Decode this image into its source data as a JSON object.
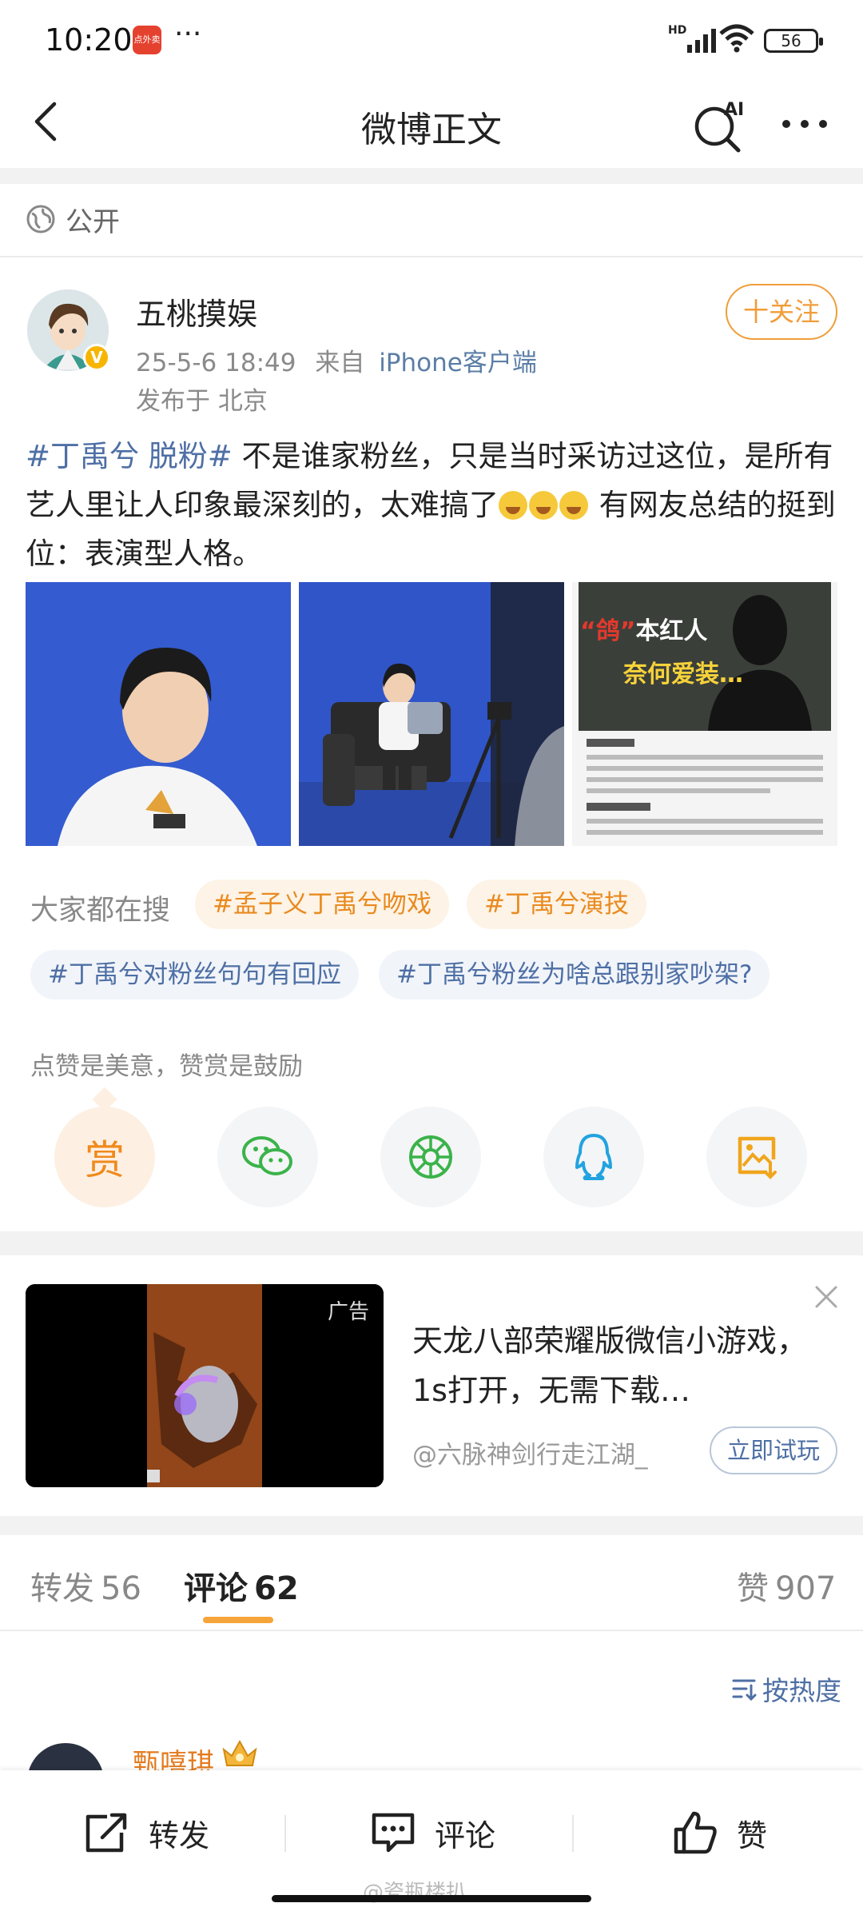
{
  "status_bar": {
    "time": "10:20",
    "app_icon_text": "点外卖",
    "dots": "···",
    "network": "HD",
    "battery": "56"
  },
  "nav": {
    "title": "微博正文",
    "ai_label": "AI"
  },
  "visibility": "公开",
  "author": {
    "name": "五桃摸娱",
    "time": "25-5-6 18:49",
    "from_prefix": "来自",
    "client": "iPhone客户端",
    "location": "发布于 北京",
    "follow_label": "十关注"
  },
  "post": {
    "tag": "#丁禹兮 脱粉#",
    "text_before_emoji": " 不是谁家粉丝，只是当时采访过这位，是所有艺人里让人印象最深刻的，太难搞了",
    "text_after_emoji": " 有网友总结的挺到位：表演型人格。",
    "image3_caption_line1_quote": "“鸽”",
    "image3_caption_line1_rest": "本红人",
    "image3_caption_line2": "奈何爱装…"
  },
  "hot_search": {
    "label": "大家都在搜",
    "chips": [
      "#孟子义丁禹兮吻戏",
      "#丁禹兮演技",
      "#丁禹兮对粉丝句句有回应",
      "#丁禹兮粉丝为啥总跟别家吵架?"
    ]
  },
  "reward": {
    "hint": "点赞是美意，赞赏是鼓励",
    "reward_char": "赏"
  },
  "ad": {
    "badge": "广告",
    "title": "天龙八部荣耀版微信小游戏，1s打开，无需下载…",
    "source": "@六脉神剑行走江湖_",
    "button": "立即试玩"
  },
  "tabs": [
    {
      "label": "转发",
      "count": "56"
    },
    {
      "label": "评论",
      "count": "62"
    },
    {
      "label": "赞",
      "count": "907"
    }
  ],
  "sort_label": "按热度",
  "first_comment": {
    "name": "甄嘻琪"
  },
  "actions": {
    "repost": "转发",
    "comment": "评论",
    "like": "赞"
  },
  "watermark": "@瓷瓶楼扒",
  "colors": {
    "accent_orange": "#f09d3a",
    "link_blue": "#4e6fa5"
  }
}
